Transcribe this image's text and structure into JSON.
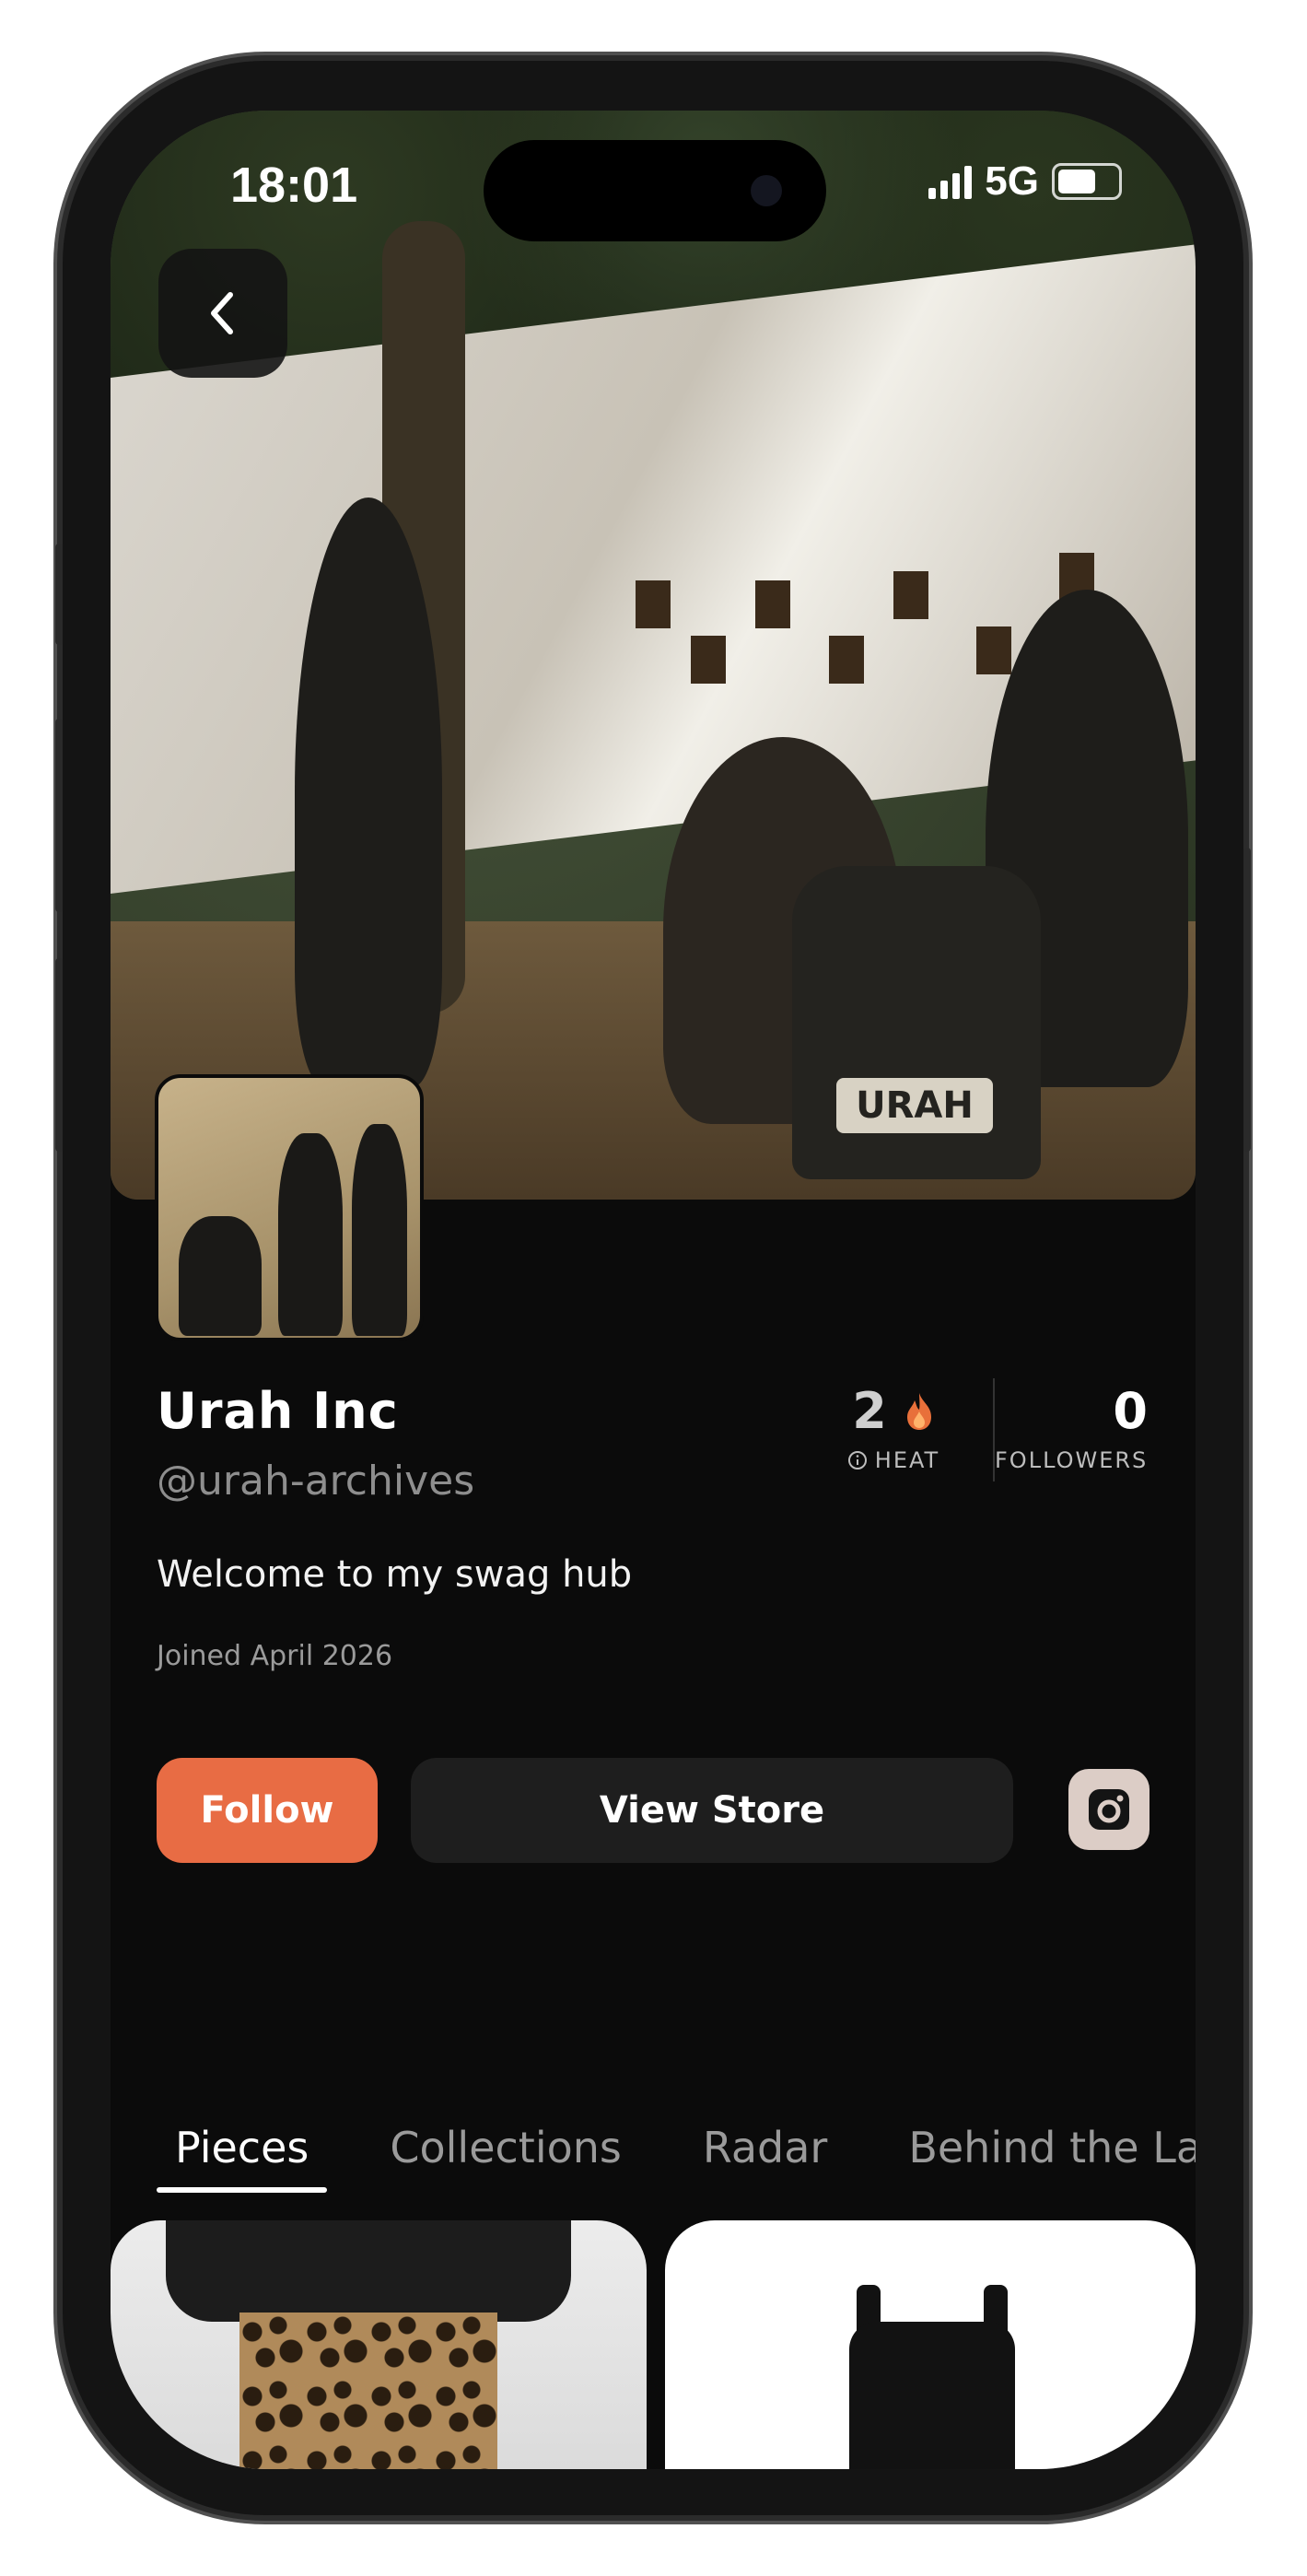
{
  "status_bar": {
    "time": "18:01",
    "network": "5G"
  },
  "profile": {
    "name": "Urah Inc",
    "handle": "@urah-archives",
    "bio": "Welcome to my swag hub",
    "joined": "Joined April 2026",
    "hero_bag_text": "URAH"
  },
  "stats": {
    "heat": {
      "value": "2",
      "label": "HEAT"
    },
    "followers": {
      "value": "0",
      "label": "FOLLOWERS"
    }
  },
  "actions": {
    "follow_label": "Follow",
    "store_label": "View Store"
  },
  "tabs": [
    {
      "label": "Pieces",
      "active": true
    },
    {
      "label": "Collections",
      "active": false
    },
    {
      "label": "Radar",
      "active": false
    },
    {
      "label": "Behind the Label",
      "active": false
    }
  ],
  "colors": {
    "accent": "#E86C44",
    "background": "#0B0B0B",
    "instagram_bg": "#DCCDC6"
  },
  "icons": [
    "chevron-left-icon",
    "flame-icon",
    "info-icon",
    "instagram-icon"
  ]
}
